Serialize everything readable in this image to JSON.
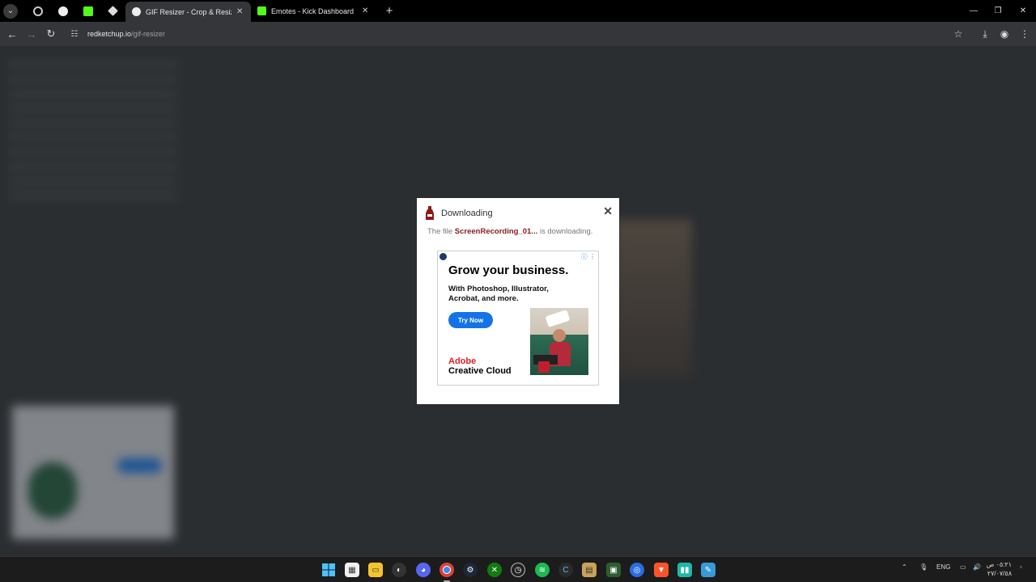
{
  "browser": {
    "tabs": [
      {
        "title": "GIF Resizer - Crop & Resize Ani",
        "active": true
      },
      {
        "title": "Emotes - Kick Dashboard",
        "active": false
      }
    ],
    "url_host": "redketchup.io",
    "url_path": "/gif-resizer"
  },
  "dialog": {
    "title": "Downloading",
    "message_prefix": "The file ",
    "file_name": "ScreenRecording_01...",
    "message_suffix": " is downloading.",
    "close_glyph": "✕"
  },
  "ad": {
    "headline": "Grow your business.",
    "subline": "With Photoshop, Illustrator, Acrobat, and more.",
    "cta": "Try Now",
    "brand_line1": "Adobe",
    "brand_line2": "Creative Cloud"
  },
  "taskbar": {
    "lang": "ENG",
    "clock_time": "٠٥:٢١ ص",
    "clock_date": "٢٧/٠٧/٥٨"
  },
  "colors": {
    "accent_blue": "#1473e6",
    "adobe_red": "#e01f1f",
    "file_name": "#8b1a1a",
    "kick_green": "#53fc18"
  }
}
